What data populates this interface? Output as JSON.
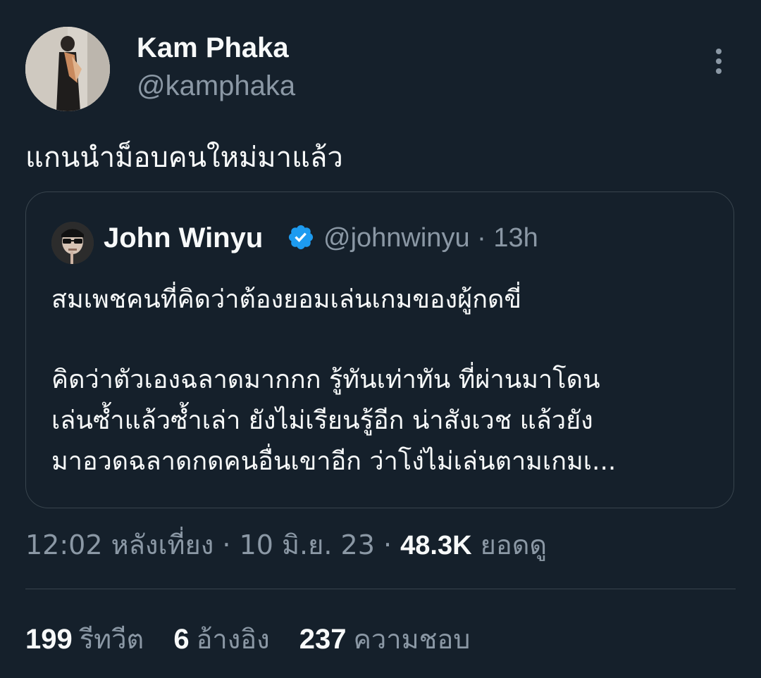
{
  "tweet": {
    "author": {
      "display_name": "Kam Phaka",
      "handle": "@kamphaka"
    },
    "text": "แกนนำม็อบคนใหม่มาแล้ว",
    "quoted": {
      "display_name": "John Winyu",
      "handle_time": "@johnwinyu · 13h",
      "lines": [
        "สมเพชคนที่คิดว่าต้องยอมเล่นเกมของผู้กดขี่",
        "คิดว่าตัวเองฉลาดมากกก รู้ทันเท่าทัน ที่ผ่านมาโดน",
        "เล่นซ้ำแล้วซ้ำเล่า ยังไม่เรียนรู้อีก น่าสังเวช แล้วยัง",
        "มาอวดฉลาดกดคนอื่นเขาอีก ว่าโง่ไม่เล่นตามเกมเ..."
      ]
    },
    "meta": {
      "timestamp": "12:02 หลังเที่ยง · 10 มิ.ย. 23 · ",
      "views_count": "48.3K",
      "views_label": "ยอดดู"
    },
    "stats": {
      "retweets_count": "199",
      "retweets_label": "รีทวีต",
      "quotes_count": "6",
      "quotes_label": "อ้างอิง",
      "likes_count": "237",
      "likes_label": "ความชอบ"
    }
  },
  "icons": {
    "more": "more-vertical-icon",
    "verified": "verified-badge-icon"
  },
  "colors": {
    "background": "#15202b",
    "text_primary": "#f7f9f9",
    "text_secondary": "#8b98a5",
    "border": "#38444d",
    "verified": "#1d9bf0"
  }
}
